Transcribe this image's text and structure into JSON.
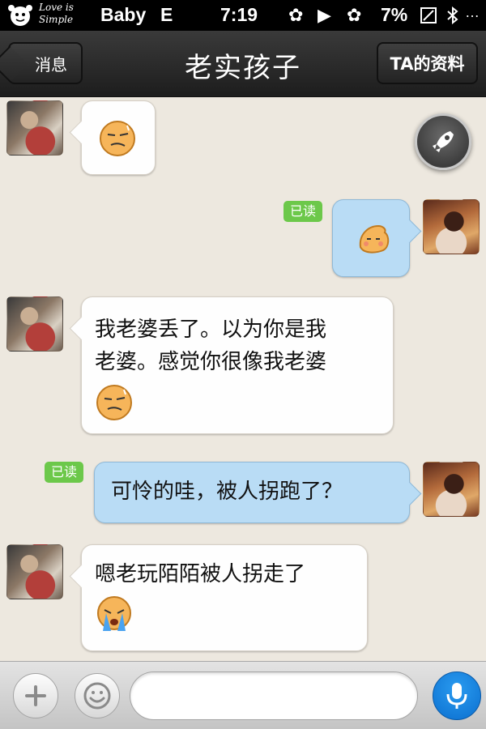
{
  "status_bar": {
    "logo_text": "Love is Simple",
    "carrier": "Baby",
    "network": "E",
    "time": "7:19",
    "battery": "7%"
  },
  "nav": {
    "back_label": "消息",
    "title": "老实孩子",
    "profile_label": "TA的资料"
  },
  "messages": [
    {
      "side": "left",
      "text": "",
      "emoji": "smug-emoji"
    },
    {
      "side": "right",
      "text": "",
      "emoji": "shy-blob-emoji",
      "read": "已读"
    },
    {
      "side": "left",
      "lines": [
        "我老婆丢了。以为你是我",
        "老婆。感觉你很像我老婆"
      ],
      "emoji": "smug-emoji"
    },
    {
      "side": "right",
      "text": "可怜的哇，被人拐跑了？",
      "read": "已读"
    },
    {
      "side": "left",
      "text": "嗯老玩陌陌被人拐走了",
      "emoji": "crying-emoji"
    }
  ],
  "input": {
    "placeholder": ""
  },
  "colors": {
    "chat_bg": "#ede8df",
    "bubble_left": "#fefefe",
    "bubble_right": "#b9dcf5",
    "read_badge": "#6cc84a",
    "mic": "#0b6fcf"
  }
}
